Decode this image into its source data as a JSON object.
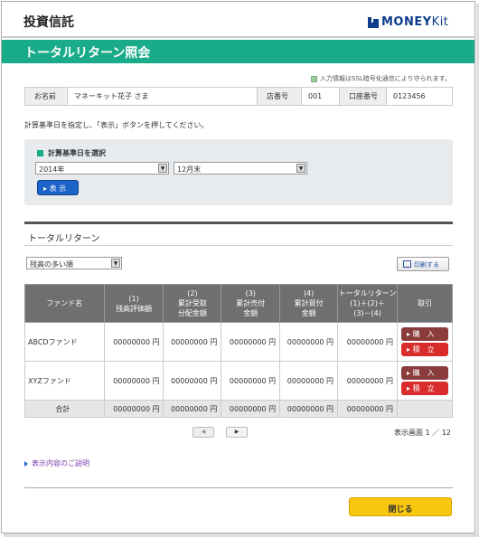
{
  "header": {
    "brand": "投資信託",
    "logo_prefix": "MONEY",
    "logo_suffix": "Kit"
  },
  "banner": {
    "title": "トータルリターン照会"
  },
  "ssl_note": "入力情報はSSL暗号化通信により守られます。",
  "customer": {
    "name_label": "お名前",
    "name_value": "マネーキット花子 さま",
    "branch_label": "店番号",
    "branch_value": "001",
    "account_label": "口座番号",
    "account_value": "0123456"
  },
  "instruction": "計算基準日を指定し、「表示」ボタンを押してください。",
  "date_select": {
    "heading": "計算基準日を選択",
    "year_value": "2014年",
    "month_value": "12月末",
    "show_label": "表 示"
  },
  "section_title": "トータルリターン",
  "sort": {
    "value": "残高の多い順"
  },
  "print_label": "印刷する",
  "table": {
    "headers": [
      "ファンド名",
      "(1)\n残高評価額",
      "(2)\n累計受取\n分配金額",
      "(3)\n累計売付\n金額",
      "(4)\n累計買付\n金額",
      "トータルリターン\n(1)＋(2)＋\n(3)－(4)",
      "取引"
    ],
    "rows": [
      {
        "fund": "ABCDファンド",
        "c1": "00000000 円",
        "c2": "00000000 円",
        "c3": "00000000 円",
        "c4": "00000000 円",
        "c5": "00000000 円"
      },
      {
        "fund": "XYZファンド",
        "c1": "00000000 円",
        "c2": "00000000 円",
        "c3": "00000000 円",
        "c4": "00000000 円",
        "c5": "00000000 円"
      }
    ],
    "total": {
      "label": "合計",
      "c1": "00000000 円",
      "c2": "00000000 円",
      "c3": "00000000 円",
      "c4": "00000000 円",
      "c5": "00000000 円"
    },
    "buy_label": "購　入",
    "accumulate_label": "積　立"
  },
  "pager": {
    "prev": "◀",
    "next": "▶",
    "info": "表示画面  1 ／ 12"
  },
  "explain_link": "表示内容のご説明",
  "close_label": "閉じる",
  "colors": {
    "accent": "#1aab8a",
    "brand_blue": "#0d3d8c",
    "close_button": "#f9c80e",
    "buy_button": "#8a3c3c",
    "accumulate_button": "#d82b2b"
  }
}
